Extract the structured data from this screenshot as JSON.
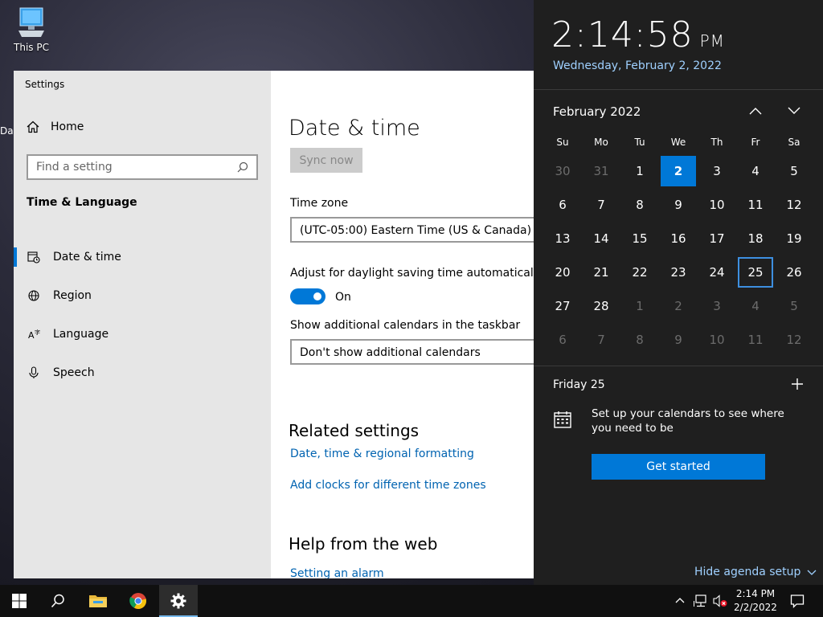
{
  "desktop": {
    "this_pc_label": "This PC",
    "fragment_label": "Da"
  },
  "settings": {
    "window_title": "Settings",
    "home_label": "Home",
    "search_placeholder": "Find a setting",
    "section_title": "Time & Language",
    "nav": [
      {
        "label": "Date & time",
        "icon": "calendar-clock-icon",
        "active": true
      },
      {
        "label": "Region",
        "icon": "globe-icon",
        "active": false
      },
      {
        "label": "Language",
        "icon": "language-icon",
        "active": false
      },
      {
        "label": "Speech",
        "icon": "microphone-icon",
        "active": false
      }
    ],
    "page_title": "Date & time",
    "sync_label": "Sync now",
    "timezone_label": "Time zone",
    "timezone_value": "(UTC-05:00) Eastern Time (US & Canada)",
    "dst_label": "Adjust for daylight saving time automatically",
    "dst_state": "On",
    "calendars_label": "Show additional calendars in the taskbar",
    "calendars_value": "Don't show additional calendars",
    "related_heading": "Related settings",
    "related_links": [
      "Date, time & regional formatting",
      "Add clocks for different time zones"
    ],
    "help_heading": "Help from the web",
    "help_link": "Setting an alarm"
  },
  "flyout": {
    "time": "2:14:58",
    "ampm": "PM",
    "date_long": "Wednesday, February 2, 2022",
    "month_label": "February 2022",
    "dow": [
      "Su",
      "Mo",
      "Tu",
      "We",
      "Th",
      "Fr",
      "Sa"
    ],
    "weeks": [
      [
        {
          "d": "30",
          "dim": true
        },
        {
          "d": "31",
          "dim": true
        },
        {
          "d": "1"
        },
        {
          "d": "2",
          "today": true
        },
        {
          "d": "3"
        },
        {
          "d": "4"
        },
        {
          "d": "5"
        }
      ],
      [
        {
          "d": "6"
        },
        {
          "d": "7"
        },
        {
          "d": "8"
        },
        {
          "d": "9"
        },
        {
          "d": "10"
        },
        {
          "d": "11"
        },
        {
          "d": "12"
        }
      ],
      [
        {
          "d": "13"
        },
        {
          "d": "14"
        },
        {
          "d": "15"
        },
        {
          "d": "16"
        },
        {
          "d": "17"
        },
        {
          "d": "18"
        },
        {
          "d": "19"
        }
      ],
      [
        {
          "d": "20"
        },
        {
          "d": "21"
        },
        {
          "d": "22"
        },
        {
          "d": "23"
        },
        {
          "d": "24"
        },
        {
          "d": "25",
          "selected": true
        },
        {
          "d": "26"
        }
      ],
      [
        {
          "d": "27"
        },
        {
          "d": "28"
        },
        {
          "d": "1",
          "dim": true
        },
        {
          "d": "2",
          "dim": true
        },
        {
          "d": "3",
          "dim": true
        },
        {
          "d": "4",
          "dim": true
        },
        {
          "d": "5",
          "dim": true
        }
      ],
      [
        {
          "d": "6",
          "dim": true
        },
        {
          "d": "7",
          "dim": true
        },
        {
          "d": "8",
          "dim": true
        },
        {
          "d": "9",
          "dim": true
        },
        {
          "d": "10",
          "dim": true
        },
        {
          "d": "11",
          "dim": true
        },
        {
          "d": "12",
          "dim": true
        }
      ]
    ],
    "agenda_day": "Friday 25",
    "agenda_message": "Set up your calendars to see where you need to be",
    "get_started_label": "Get started",
    "hide_agenda_label": "Hide agenda setup"
  },
  "taskbar": {
    "apps": [
      "start-icon",
      "search-icon",
      "file-explorer-icon",
      "chrome-icon",
      "settings-gear-icon"
    ],
    "tray_time": "2:14 PM",
    "tray_date": "2/2/2022"
  },
  "colors": {
    "accent": "#0078d7",
    "link": "#0063b1",
    "flyout_bg": "#1f1f1f",
    "flyout_link": "#9fd0ff"
  }
}
